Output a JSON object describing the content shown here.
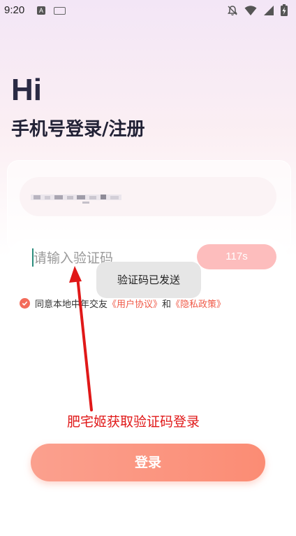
{
  "status_bar": {
    "time": "9:20",
    "keyboard_indicator": "A"
  },
  "header": {
    "greeting": "Hi",
    "title": "手机号登录/注册"
  },
  "phone_field": {
    "value": ""
  },
  "code_field": {
    "placeholder": "请输入验证码",
    "countdown": "117s"
  },
  "toast": {
    "message": "验证码已发送"
  },
  "agreement": {
    "prefix": "同意本地中年交友",
    "user_agreement": "《用户协议》",
    "connector": "和",
    "privacy_policy": "《隐私政策》"
  },
  "annotation": {
    "text": "肥宅姬获取验证码登录",
    "color": "#e01818"
  },
  "login_button": {
    "label": "登录"
  },
  "colors": {
    "accent": "#f36b5a",
    "button": "#fb8c74",
    "countdown_bg": "#fdbdbd"
  },
  "icons": [
    "notification-off-icon",
    "wifi-icon",
    "signal-icon",
    "battery-icon",
    "check-icon"
  ]
}
